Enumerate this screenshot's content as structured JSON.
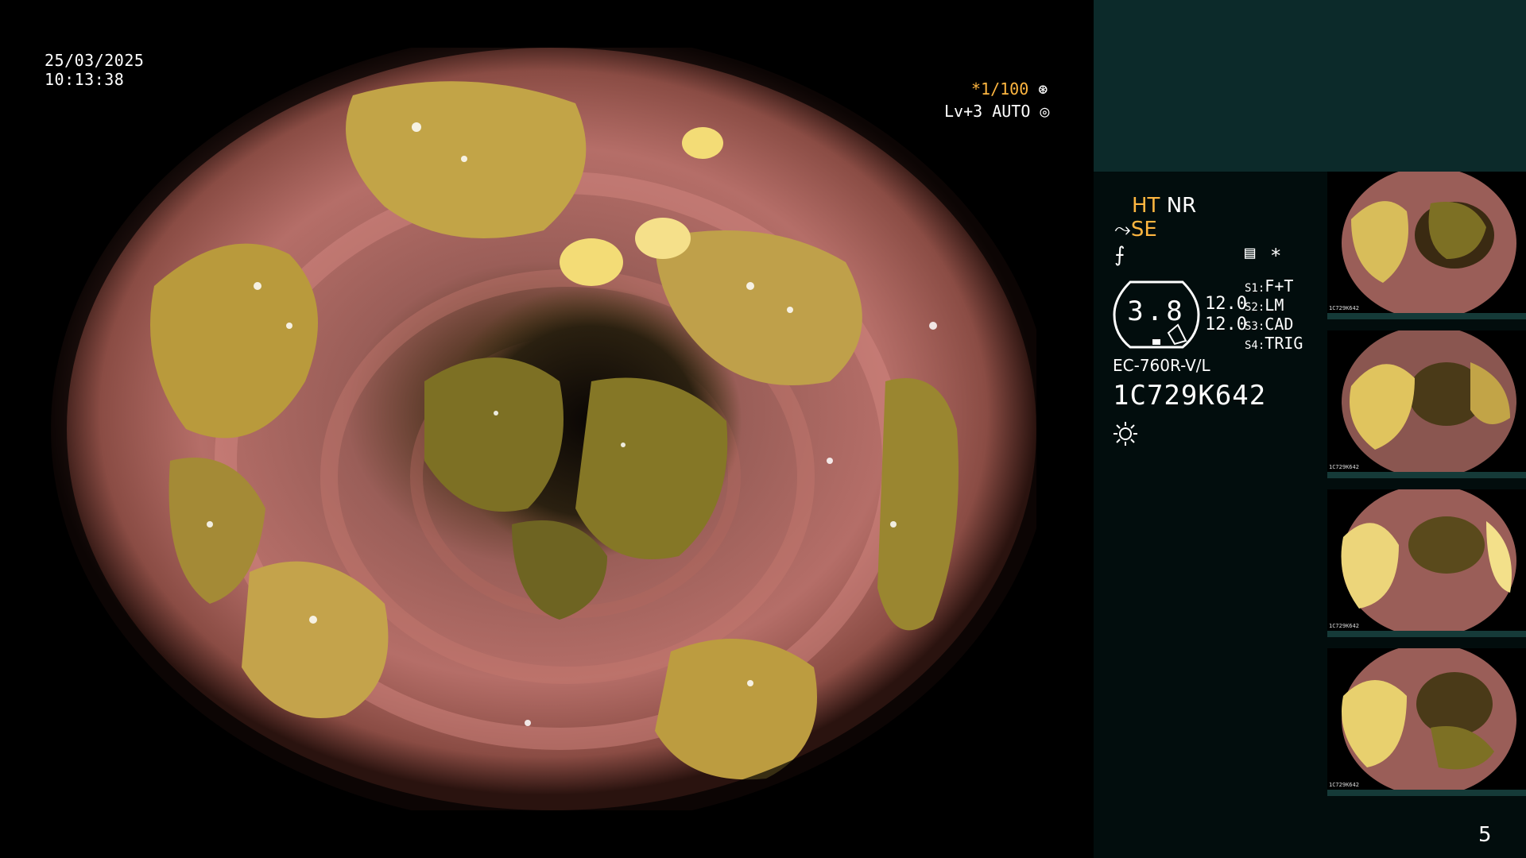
{
  "overlay": {
    "date": "25/03/2025",
    "time": "10:13:38",
    "shutter": "*1/100",
    "shutter_icon": "aperture-icon",
    "level": "Lv+3 AUTO",
    "level_icon": "target-icon"
  },
  "panel": {
    "mode_ht": "HT",
    "mode_nr": "NR",
    "mode_se": "SE",
    "gauge_value": "3.8",
    "num1": "12.0",
    "num2": "12.0",
    "star": "*",
    "switches": [
      {
        "key": "S1",
        "value": "F+T"
      },
      {
        "key": "S2",
        "value": "LM"
      },
      {
        "key": "S3",
        "value": "CAD"
      },
      {
        "key": "S4",
        "value": "TRIG"
      }
    ],
    "model": "EC-760R-V/L",
    "serial": "1C729K642",
    "page": "5"
  },
  "thumbnails": [
    {
      "id": "1C729K642"
    },
    {
      "id": "1C729K642"
    },
    {
      "id": "1C729K642"
    },
    {
      "id": "1C729K642"
    }
  ],
  "colors": {
    "panel_dark": "#020d0d",
    "panel_top": "#0c2a2a",
    "accent_orange": "#ffb640",
    "mucosa": "#a8675c",
    "debris": "#b99a3c"
  }
}
